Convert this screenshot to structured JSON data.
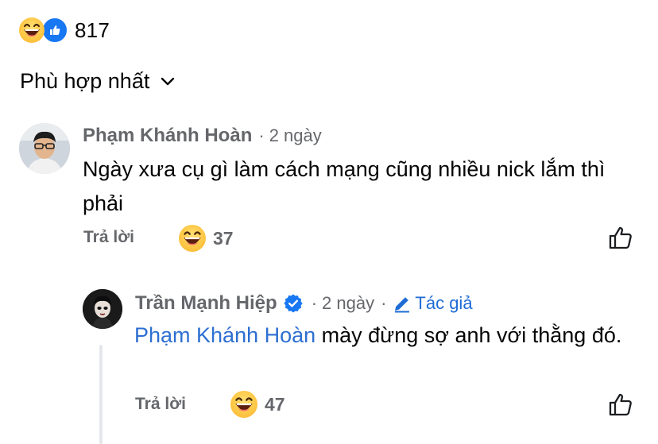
{
  "reactions": {
    "count": "817",
    "types": [
      "haha-emoji",
      "like-icon"
    ]
  },
  "sort": {
    "label": "Phù hợp nhất"
  },
  "comments": [
    {
      "author": "Phạm Khánh Hoàn",
      "separator": "·",
      "time": "2 ngày",
      "text": "Ngày xưa cụ gì làm cách mạng cũng nhiều nick lắm thì phải",
      "reply_label": "Trả lời",
      "reaction_count": "37",
      "reaction": "haha-emoji"
    },
    {
      "author": "Trần Mạnh Hiệp",
      "verified": true,
      "separator": "·",
      "time": "2 ngày",
      "author_badge": "Tác giả",
      "mention": "Phạm Khánh Hoàn",
      "text": " mày đừng sợ anh với thằng đó.",
      "reply_label": "Trả lời",
      "reaction_count": "47",
      "reaction": "haha-emoji"
    }
  ],
  "colors": {
    "link": "#1f6bd6",
    "secondary_text": "#65676b",
    "like_blue": "#1877f2"
  }
}
